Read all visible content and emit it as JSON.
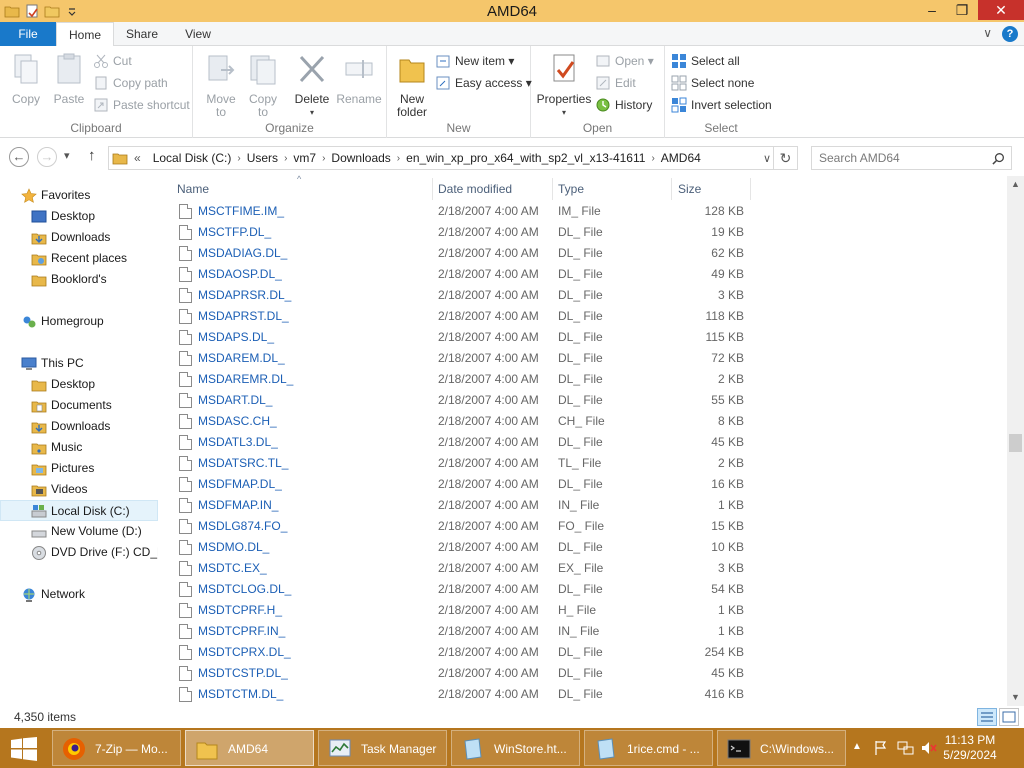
{
  "window": {
    "title": "AMD64",
    "minimize": "–",
    "restore": "❐",
    "close": "✕"
  },
  "ribbon_tabs": {
    "file": "File",
    "home": "Home",
    "share": "Share",
    "view": "View",
    "collapse": "∨",
    "help": "?"
  },
  "ribbon": {
    "clipboard": {
      "label": "Clipboard",
      "copy": "Copy",
      "paste": "Paste",
      "cut": "Cut",
      "copy_path": "Copy path",
      "paste_shortcut": "Paste shortcut"
    },
    "organize": {
      "label": "Organize",
      "move_to_1": "Move",
      "move_to_2": "to",
      "copy_to_1": "Copy",
      "copy_to_2": "to",
      "delete": "Delete",
      "rename": "Rename"
    },
    "new": {
      "label": "New",
      "new_folder_1": "New",
      "new_folder_2": "folder",
      "new_item": "New item",
      "easy_access": "Easy access"
    },
    "open": {
      "label": "Open",
      "properties": "Properties",
      "open": "Open",
      "edit": "Edit",
      "history": "History"
    },
    "select": {
      "label": "Select",
      "select_all": "Select all",
      "select_none": "Select none",
      "invert_selection": "Invert selection"
    }
  },
  "address": {
    "back": "←",
    "forward": "→",
    "recent": "▾",
    "up": "↑",
    "overflow": "«",
    "crumbs": [
      "Local Disk (C:)",
      "Users",
      "vm7",
      "Downloads",
      "en_win_xp_pro_x64_with_sp2_vl_x13-41611",
      "AMD64"
    ],
    "dropdown": "∨",
    "refresh": "↻",
    "search_placeholder": "Search AMD64"
  },
  "navpane": {
    "favorites": "Favorites",
    "desktop": "Desktop",
    "downloads": "Downloads",
    "recent_places": "Recent places",
    "booklord": "Booklord's",
    "homegroup": "Homegroup",
    "this_pc": "This PC",
    "pc_desktop": "Desktop",
    "pc_documents": "Documents",
    "pc_downloads": "Downloads",
    "pc_music": "Music",
    "pc_pictures": "Pictures",
    "pc_videos": "Videos",
    "local_disk": "Local Disk (C:)",
    "new_volume": "New Volume (D:)",
    "dvd_drive": "DVD Drive (F:) CD_R(",
    "network": "Network"
  },
  "columns": {
    "name": "Name",
    "date_modified": "Date modified",
    "type": "Type",
    "size": "Size"
  },
  "files": [
    {
      "name": "MSCTFIME.IM_",
      "date": "2/18/2007 4:00 AM",
      "type": "IM_ File",
      "size": "128 KB"
    },
    {
      "name": "MSCTFP.DL_",
      "date": "2/18/2007 4:00 AM",
      "type": "DL_ File",
      "size": "19 KB"
    },
    {
      "name": "MSDADIAG.DL_",
      "date": "2/18/2007 4:00 AM",
      "type": "DL_ File",
      "size": "62 KB"
    },
    {
      "name": "MSDAOSP.DL_",
      "date": "2/18/2007 4:00 AM",
      "type": "DL_ File",
      "size": "49 KB"
    },
    {
      "name": "MSDAPRSR.DL_",
      "date": "2/18/2007 4:00 AM",
      "type": "DL_ File",
      "size": "3 KB"
    },
    {
      "name": "MSDAPRST.DL_",
      "date": "2/18/2007 4:00 AM",
      "type": "DL_ File",
      "size": "118 KB"
    },
    {
      "name": "MSDAPS.DL_",
      "date": "2/18/2007 4:00 AM",
      "type": "DL_ File",
      "size": "115 KB"
    },
    {
      "name": "MSDAREM.DL_",
      "date": "2/18/2007 4:00 AM",
      "type": "DL_ File",
      "size": "72 KB"
    },
    {
      "name": "MSDAREMR.DL_",
      "date": "2/18/2007 4:00 AM",
      "type": "DL_ File",
      "size": "2 KB"
    },
    {
      "name": "MSDART.DL_",
      "date": "2/18/2007 4:00 AM",
      "type": "DL_ File",
      "size": "55 KB"
    },
    {
      "name": "MSDASC.CH_",
      "date": "2/18/2007 4:00 AM",
      "type": "CH_ File",
      "size": "8 KB"
    },
    {
      "name": "MSDATL3.DL_",
      "date": "2/18/2007 4:00 AM",
      "type": "DL_ File",
      "size": "45 KB"
    },
    {
      "name": "MSDATSRC.TL_",
      "date": "2/18/2007 4:00 AM",
      "type": "TL_ File",
      "size": "2 KB"
    },
    {
      "name": "MSDFMAP.DL_",
      "date": "2/18/2007 4:00 AM",
      "type": "DL_ File",
      "size": "16 KB"
    },
    {
      "name": "MSDFMAP.IN_",
      "date": "2/18/2007 4:00 AM",
      "type": "IN_ File",
      "size": "1 KB"
    },
    {
      "name": "MSDLG874.FO_",
      "date": "2/18/2007 4:00 AM",
      "type": "FO_ File",
      "size": "15 KB"
    },
    {
      "name": "MSDMO.DL_",
      "date": "2/18/2007 4:00 AM",
      "type": "DL_ File",
      "size": "10 KB"
    },
    {
      "name": "MSDTC.EX_",
      "date": "2/18/2007 4:00 AM",
      "type": "EX_ File",
      "size": "3 KB"
    },
    {
      "name": "MSDTCLOG.DL_",
      "date": "2/18/2007 4:00 AM",
      "type": "DL_ File",
      "size": "54 KB"
    },
    {
      "name": "MSDTCPRF.H_",
      "date": "2/18/2007 4:00 AM",
      "type": "H_ File",
      "size": "1 KB"
    },
    {
      "name": "MSDTCPRF.IN_",
      "date": "2/18/2007 4:00 AM",
      "type": "IN_ File",
      "size": "1 KB"
    },
    {
      "name": "MSDTCPRX.DL_",
      "date": "2/18/2007 4:00 AM",
      "type": "DL_ File",
      "size": "254 KB"
    },
    {
      "name": "MSDTCSTP.DL_",
      "date": "2/18/2007 4:00 AM",
      "type": "DL_ File",
      "size": "45 KB"
    },
    {
      "name": "MSDTCTM.DL_",
      "date": "2/18/2007 4:00 AM",
      "type": "DL_ File",
      "size": "416 KB"
    }
  ],
  "scrollbar": {
    "up": "▲",
    "down": "▼"
  },
  "status": {
    "item_count": "4,350 items"
  },
  "taskbar": {
    "firefox": "7-Zip — Mo...",
    "explorer": "AMD64",
    "task_manager": "Task Manager",
    "winstore": "WinStore.ht...",
    "rice": "1rice.cmd - ...",
    "cmd": "C:\\Windows...",
    "time": "11:13 PM",
    "date": "5/29/2024"
  },
  "colors": {
    "title_bar": "#f5c66b",
    "file_tab": "#1979ca",
    "taskbar": "#b5761e",
    "link_text": "#1c5fb5",
    "close_button": "#c7312b"
  },
  "icons": [
    "folder-icon",
    "properties-icon",
    "star-icon",
    "homegroup-icon",
    "pc-icon",
    "drive-icon",
    "dvd-icon",
    "network-icon",
    "file-icon",
    "firefox-icon",
    "cmd-icon",
    "flag-icon",
    "speaker-muted-icon"
  ]
}
